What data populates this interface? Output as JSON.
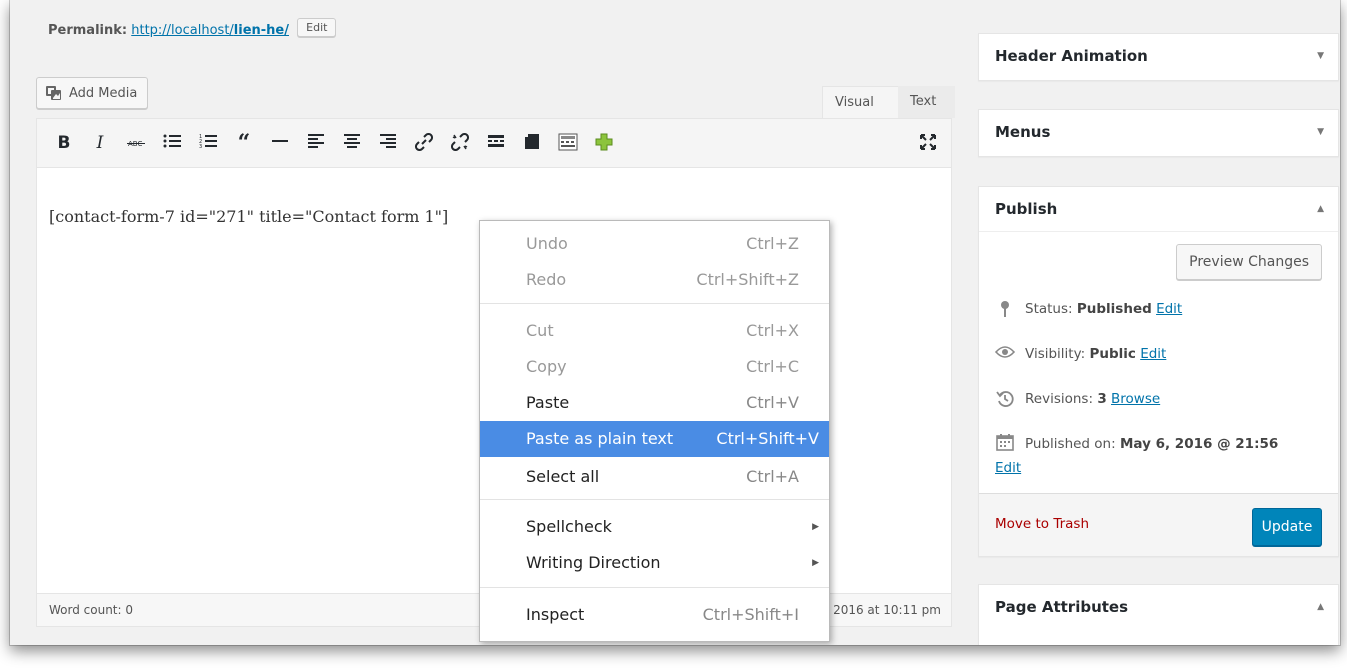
{
  "permalink": {
    "label": "Permalink:",
    "url_prefix": "http://localhost/",
    "slug": "lien-he/",
    "edit_label": "Edit"
  },
  "editor": {
    "add_media_label": "Add Media",
    "tabs": {
      "visual": "Visual",
      "text": "Text"
    },
    "content": "[contact-form-7 id=\"271\" title=\"Contact form 1\"]",
    "word_count": "Word count: 0",
    "last_edited_fragment": "2016 at 10:11 pm",
    "toolbar": [
      "bold-icon",
      "italic-icon",
      "strikethrough-icon",
      "bullet-list-icon",
      "numbered-list-icon",
      "blockquote-icon",
      "horizontal-line-icon",
      "align-left-icon",
      "align-center-icon",
      "align-right-icon",
      "insert-link-icon",
      "remove-link-icon",
      "read-more-icon",
      "toolbar-toggle-icon",
      "form-icon",
      "add-icon",
      "fullscreen-icon"
    ]
  },
  "sidebar": {
    "header_animation": {
      "title": "Header Animation",
      "toggle": "▼"
    },
    "menus": {
      "title": "Menus",
      "toggle": "▼"
    },
    "publish": {
      "title": "Publish",
      "toggle": "▲",
      "preview_label": "Preview Changes",
      "status_label": "Status:",
      "status_value": "Published",
      "visibility_label": "Visibility:",
      "visibility_value": "Public",
      "revisions_label": "Revisions:",
      "revisions_value": "3",
      "browse_label": "Browse",
      "published_on_label": "Published on:",
      "published_on_value": "May 6, 2016 @ 21:56",
      "edit_label": "Edit",
      "trash_label": "Move to Trash",
      "update_label": "Update"
    },
    "page_attributes": {
      "title": "Page Attributes",
      "toggle": "▲"
    }
  },
  "context_menu": {
    "items": [
      {
        "label": "Undo",
        "shortcut": "Ctrl+Z",
        "state": "disabled"
      },
      {
        "label": "Redo",
        "shortcut": "Ctrl+Shift+Z",
        "state": "disabled"
      },
      {
        "label": "Cut",
        "shortcut": "Ctrl+X",
        "state": "disabled"
      },
      {
        "label": "Copy",
        "shortcut": "Ctrl+C",
        "state": "disabled"
      },
      {
        "label": "Paste",
        "shortcut": "Ctrl+V",
        "state": "enabled"
      },
      {
        "label": "Paste as plain text",
        "shortcut": "Ctrl+Shift+V",
        "state": "highlighted"
      },
      {
        "label": "Select all",
        "shortcut": "Ctrl+A",
        "state": "enabled"
      },
      {
        "label": "Spellcheck",
        "submenu": true,
        "state": "enabled"
      },
      {
        "label": "Writing Direction",
        "submenu": true,
        "state": "enabled"
      },
      {
        "label": "Inspect",
        "shortcut": "Ctrl+Shift+I",
        "state": "enabled"
      }
    ]
  }
}
